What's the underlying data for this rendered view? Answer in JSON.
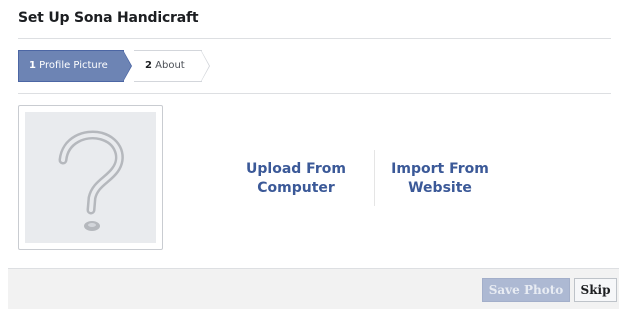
{
  "page": {
    "title": "Set Up Sona Handicraft"
  },
  "steps": [
    {
      "number": "1",
      "label": "Profile Picture",
      "state": "active"
    },
    {
      "number": "2",
      "label": "About",
      "state": "inactive"
    }
  ],
  "profile_picture": {
    "icon": "question-mark-placeholder"
  },
  "options": {
    "upload_line1": "Upload From",
    "upload_line2": "Computer",
    "import_line1": "Import From",
    "import_line2": "Website"
  },
  "footer": {
    "save_label": "Save Photo",
    "skip_label": "Skip"
  },
  "colors": {
    "accent": "#3b5998",
    "step_active": "#6d84b4",
    "placeholder_bg": "#e9ebee"
  }
}
